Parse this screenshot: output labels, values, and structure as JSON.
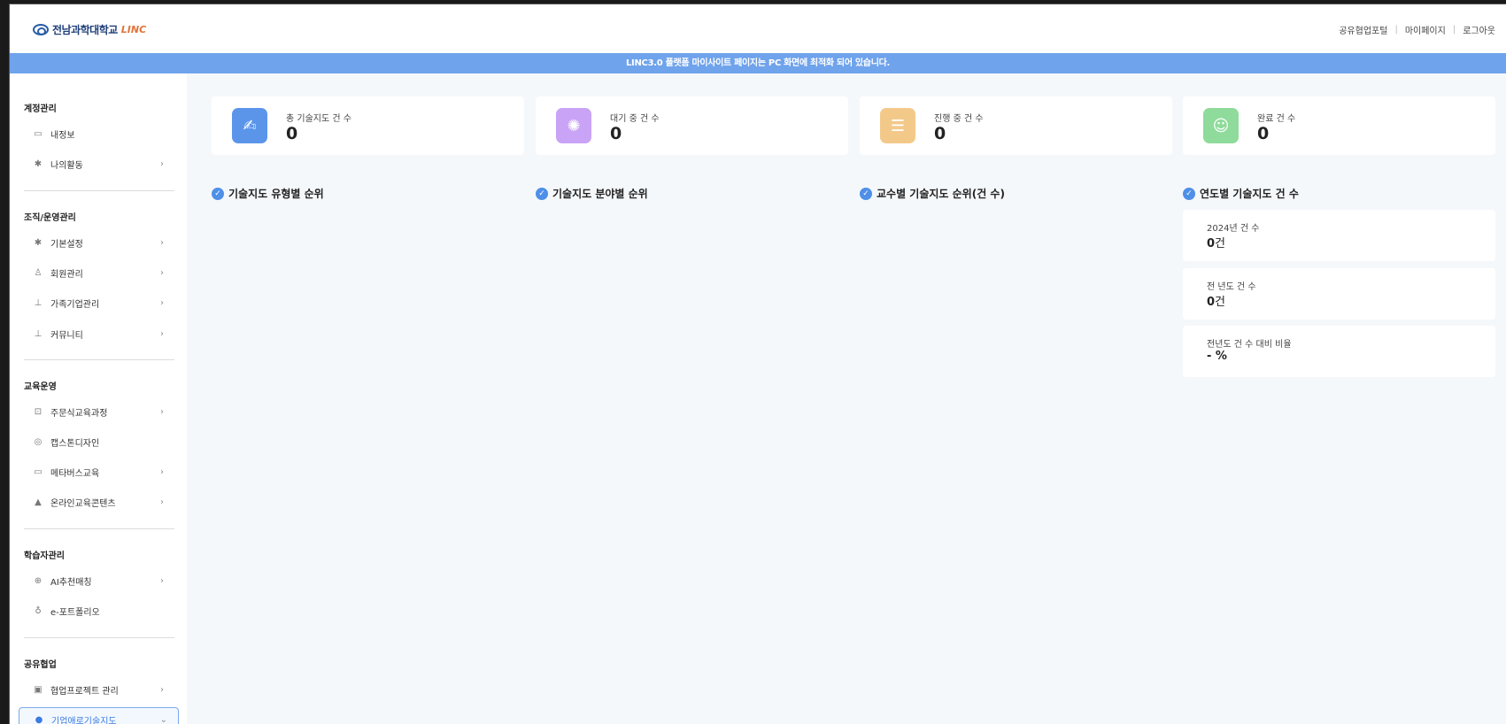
{
  "header": {
    "logo_text": "전남과학대학교",
    "logo_linc": "LINC",
    "links": [
      "공유협업포털",
      "마이페이지",
      "로그아웃"
    ]
  },
  "notice": "LINC3.0 플랫폼 마이사이트 페이지는 PC 화면에 최적화 되어 있습니다.",
  "sidebar": {
    "sections": [
      {
        "title": "계정관리",
        "items": [
          {
            "label": "내정보",
            "icon": "id-card-icon",
            "chevron": false
          },
          {
            "label": "나의활동",
            "icon": "gear-icon",
            "chevron": true
          }
        ]
      },
      {
        "title": "조직/운영관리",
        "items": [
          {
            "label": "기본설정",
            "icon": "gear-icon",
            "chevron": true
          },
          {
            "label": "회원관리",
            "icon": "user-gear-icon",
            "chevron": true
          },
          {
            "label": "가족기업관리",
            "icon": "org-chart-icon",
            "chevron": true
          },
          {
            "label": "커뮤니티",
            "icon": "org-chart-icon",
            "chevron": true
          }
        ]
      },
      {
        "title": "교육운영",
        "items": [
          {
            "label": "주문식교육과정",
            "icon": "presentation-icon",
            "chevron": true
          },
          {
            "label": "캡스톤디자인",
            "icon": "palette-icon",
            "chevron": false
          },
          {
            "label": "메타버스교육",
            "icon": "vr-headset-icon",
            "chevron": true
          },
          {
            "label": "온라인교육콘텐츠",
            "icon": "online-learning-icon",
            "chevron": true
          }
        ]
      },
      {
        "title": "학습자관리",
        "items": [
          {
            "label": "AI추천매칭",
            "icon": "target-icon",
            "chevron": true
          },
          {
            "label": "e-포트폴리오",
            "icon": "award-icon",
            "chevron": false
          }
        ]
      },
      {
        "title": "공유협업",
        "items": [
          {
            "label": "협업프로젝트 관리",
            "icon": "project-board-icon",
            "chevron": true
          },
          {
            "label": "기업애로기술지도",
            "icon": "question-icon",
            "chevron": true,
            "active": true
          }
        ]
      }
    ]
  },
  "stats": [
    {
      "label": "총 기술지도 건 수",
      "value": "0",
      "color": "#5b95ea",
      "icon": "signature-icon"
    },
    {
      "label": "대기 중 건 수",
      "value": "0",
      "color": "#c9a3f5",
      "icon": "loading-icon"
    },
    {
      "label": "진행 중 건 수",
      "value": "0",
      "color": "#f3c98a",
      "icon": "list-icon"
    },
    {
      "label": "완료 건 수",
      "value": "0",
      "color": "#8fdb9b",
      "icon": "smile-icon"
    }
  ],
  "sections": [
    "기술지도 유형별 순위",
    "기술지도 분야별 순위",
    "교수별 기술지도 순위(건 수)",
    "연도별 기술지도 건 수"
  ],
  "year_stats": [
    {
      "label": "2024년 건 수",
      "value": "0",
      "unit": "건"
    },
    {
      "label": "전 년도 건 수",
      "value": "0",
      "unit": "건"
    },
    {
      "label": "전년도 건 수 대비 비율",
      "value": "- %",
      "unit": ""
    }
  ]
}
